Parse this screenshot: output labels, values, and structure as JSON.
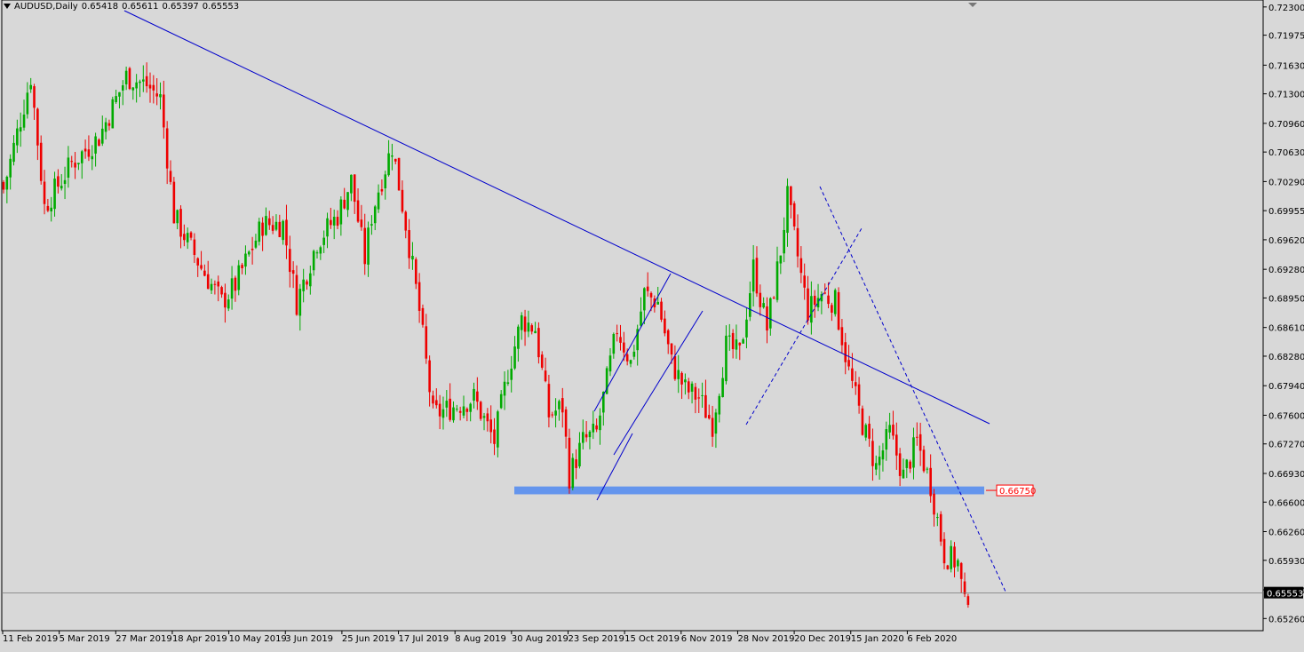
{
  "header": {
    "symbol": "AUDUSD,Daily",
    "open": "0.65418",
    "high": "0.65611",
    "low": "0.65397",
    "close": "0.65553"
  },
  "colors": {
    "background": "#d8d8d8",
    "bull": "#00aa00",
    "bear": "#ee0000",
    "trendline": "#0000cc",
    "support_zone": "#6495ed",
    "current_price_bg": "#000000",
    "level_label": "#ff0000"
  },
  "chart_data": {
    "type": "candlestick",
    "y_ticks": [
      "0.72300",
      "0.71975",
      "0.71630",
      "0.71300",
      "0.70960",
      "0.70630",
      "0.70290",
      "0.69955",
      "0.69620",
      "0.69280",
      "0.68950",
      "0.68610",
      "0.68280",
      "0.67940",
      "0.67600",
      "0.67270",
      "0.66930",
      "0.66600",
      "0.66260",
      "0.65930",
      "0.65590",
      "0.65260"
    ],
    "x_ticks": [
      "11 Feb 2019",
      "5 Mar 2019",
      "27 Mar 2019",
      "18 Apr 2019",
      "10 May 2019",
      "3 Jun 2019",
      "25 Jun 2019",
      "17 Jul 2019",
      "8 Aug 2019",
      "30 Aug 2019",
      "23 Sep 2019",
      "15 Oct 2019",
      "6 Nov 2019",
      "28 Nov 2019",
      "20 Dec 2019",
      "15 Jan 2020",
      "6 Feb 2020"
    ],
    "ylim": [
      0.6512,
      0.7238
    ],
    "current_price": "0.65553",
    "level_label": "0.66750",
    "support_zone": [
      0.6669,
      0.6678
    ],
    "anchors": [
      [
        0,
        0.702
      ],
      [
        8,
        0.715
      ],
      [
        12,
        0.7
      ],
      [
        20,
        0.705
      ],
      [
        28,
        0.708
      ],
      [
        36,
        0.715
      ],
      [
        42,
        0.714
      ],
      [
        46,
        0.7125
      ],
      [
        50,
        0.699
      ],
      [
        58,
        0.693
      ],
      [
        64,
        0.689
      ],
      [
        68,
        0.691
      ],
      [
        76,
        0.698
      ],
      [
        82,
        0.698
      ],
      [
        86,
        0.689
      ],
      [
        92,
        0.696
      ],
      [
        98,
        0.699
      ],
      [
        102,
        0.703
      ],
      [
        106,
        0.694
      ],
      [
        108,
        0.699
      ],
      [
        110,
        0.702
      ],
      [
        114,
        0.707
      ],
      [
        118,
        0.698
      ],
      [
        122,
        0.688
      ],
      [
        126,
        0.676
      ],
      [
        132,
        0.677
      ],
      [
        138,
        0.678
      ],
      [
        144,
        0.673
      ],
      [
        148,
        0.681
      ],
      [
        152,
        0.687
      ],
      [
        156,
        0.686
      ],
      [
        160,
        0.676
      ],
      [
        164,
        0.677
      ],
      [
        166,
        0.669
      ],
      [
        170,
        0.673
      ],
      [
        174,
        0.674
      ],
      [
        180,
        0.686
      ],
      [
        184,
        0.682
      ],
      [
        188,
        0.69
      ],
      [
        192,
        0.689
      ],
      [
        196,
        0.682
      ],
      [
        200,
        0.679
      ],
      [
        204,
        0.678
      ],
      [
        208,
        0.675
      ],
      [
        212,
        0.684
      ],
      [
        216,
        0.683
      ],
      [
        220,
        0.693
      ],
      [
        224,
        0.686
      ],
      [
        228,
        0.695
      ],
      [
        230,
        0.701
      ],
      [
        234,
        0.692
      ],
      [
        236,
        0.688
      ],
      [
        240,
        0.69
      ],
      [
        244,
        0.689
      ],
      [
        248,
        0.681
      ],
      [
        252,
        0.675
      ],
      [
        256,
        0.67
      ],
      [
        260,
        0.674
      ],
      [
        264,
        0.669
      ],
      [
        268,
        0.673
      ],
      [
        272,
        0.668
      ],
      [
        276,
        0.66
      ],
      [
        280,
        0.659
      ],
      [
        282,
        0.654
      ],
      [
        283,
        0.6555
      ]
    ]
  }
}
